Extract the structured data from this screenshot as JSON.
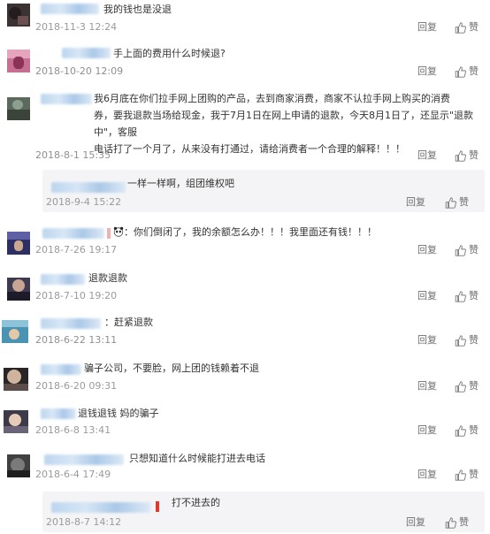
{
  "labels": {
    "reply": "回复",
    "like": "赞"
  },
  "comments": [
    {
      "text": "我的钱也是没退",
      "time": "2018-11-3 12:24"
    },
    {
      "text": "手上面的费用什么时候退?",
      "time": "2018-10-20 12:09"
    },
    {
      "text": "我6月底在你们拉手网上团购的产品，去到商家消费，商家不认拉手网上购买的消费\n券，要我退款当场给现金，我于7月1日在网上申请的退款，今天8月1日了，还显示\"退款中\"，客服\n电话打了一个月了，从来没有打通过，请给消费者一个合理的解释！！！",
      "time": "2018-8-1 15:35"
    },
    {
      "text": "一样一样啊，组团维权吧",
      "time": "2018-9-4 15:22"
    },
    {
      "text": "：你们倒闭了，我的余额怎么办！！！我里面还有钱！！！",
      "time": "2018-7-26 19:17"
    },
    {
      "text": "退款退款",
      "time": "2018-7-10 19:20"
    },
    {
      "text": "：赶紧退款",
      "time": "2018-6-22 13:11"
    },
    {
      "text": "骗子公司，不要脸，网上团的钱赖着不退",
      "time": "2018-6-20 09:31"
    },
    {
      "text": "退钱退钱 妈的骗子",
      "time": "2018-6-8 13:41"
    },
    {
      "text": "只想知道什么时候能打进去电话",
      "time": "2018-6-4 17:49"
    },
    {
      "text": "打不进去的",
      "time": "2018-8-7 14:12"
    }
  ]
}
